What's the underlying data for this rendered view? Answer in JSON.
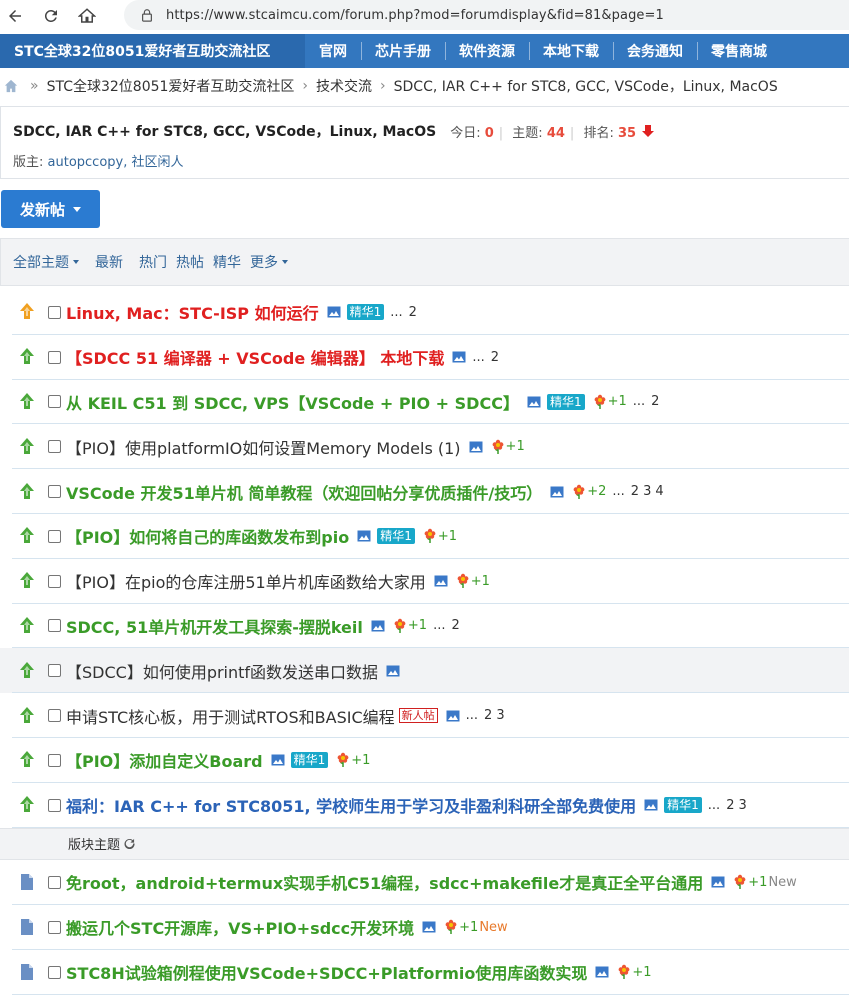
{
  "browser": {
    "url": "https://www.stcaimcu.com/forum.php?mod=forumdisplay&fid=81&page=1"
  },
  "topnav": {
    "brand": "STC全球32位8051爱好者互助交流社区",
    "items": [
      "官网",
      "芯片手册",
      "软件资源",
      "本地下载",
      "会务通知",
      "零售商城"
    ]
  },
  "breadcrumb": [
    "STC全球32位8051爱好者互助交流社区",
    "技术交流",
    "SDCC, IAR C++ for STC8, GCC, VSCode，Linux, MacOS"
  ],
  "forum": {
    "title": "SDCC, IAR C++ for STC8, GCC, VSCode，Linux, MacOS",
    "today_label": "今日:",
    "today": "0",
    "topics_label": "主题:",
    "topics": "44",
    "rank_label": "排名:",
    "rank": "35",
    "moderators_label": "版主:",
    "moderators": "autopccopy, 社区闲人"
  },
  "new_post_label": "发新帖",
  "filters": {
    "all": "全部主题",
    "latest": "最新",
    "hot": "热门",
    "hot_posts": "热帖",
    "digest": "精华",
    "more": "更多"
  },
  "section_label": "版块主题",
  "threads": [
    {
      "title": "Linux, Mac：STC-ISP 如何运行",
      "style": "red",
      "icon": "pin-up-orange-icon",
      "image": true,
      "badge": "精华1",
      "flower": false,
      "rep": "",
      "pages_prefix": "...",
      "pages": [
        "2"
      ]
    },
    {
      "title": "【SDCC 51 编译器 + VSCode 编辑器】 本地下载",
      "style": "red",
      "icon": "pin-up-green-icon",
      "image": true,
      "badge": "",
      "flower": false,
      "rep": "",
      "pages_prefix": "...",
      "pages": [
        "2"
      ]
    },
    {
      "title": "从 KEIL C51 到 SDCC, VPS【VSCode + PIO + SDCC】",
      "style": "green",
      "icon": "pin-up-green-icon",
      "image": true,
      "badge": "精华1",
      "flower": true,
      "rep": "+1",
      "pages_prefix": "...",
      "pages": [
        "2"
      ]
    },
    {
      "title": "【PIO】使用platformIO如何设置Memory Models (1)",
      "style": "dark",
      "icon": "pin-up-green-icon",
      "image": true,
      "badge": "",
      "flower": true,
      "rep": "+1",
      "pages_prefix": "",
      "pages": []
    },
    {
      "title": "VSCode 开发51单片机 简单教程（欢迎回帖分享优质插件/技巧）",
      "style": "green",
      "icon": "pin-up-green-icon",
      "image": true,
      "badge": "",
      "flower": true,
      "rep": "+2",
      "pages_prefix": "...",
      "pages": [
        "2",
        "3",
        "4"
      ]
    },
    {
      "title": "【PIO】如何将自己的库函数发布到pio",
      "style": "green",
      "icon": "pin-up-green-icon",
      "image": true,
      "badge": "精华1",
      "flower": true,
      "rep": "+1",
      "pages_prefix": "",
      "pages": []
    },
    {
      "title": "【PIO】在pio的仓库注册51单片机库函数给大家用",
      "style": "dark",
      "icon": "pin-up-green-icon",
      "image": true,
      "badge": "",
      "flower": true,
      "rep": "+1",
      "pages_prefix": "",
      "pages": []
    },
    {
      "title": "SDCC, 51单片机开发工具探索-摆脱keil",
      "style": "green",
      "icon": "pin-up-green-icon",
      "image": true,
      "badge": "",
      "flower": true,
      "rep": "+1",
      "pages_prefix": "...",
      "pages": [
        "2"
      ]
    },
    {
      "title": "【SDCC】如何使用printf函数发送串口数据",
      "style": "dark",
      "icon": "pin-up-green-icon",
      "image": true,
      "badge": "",
      "flower": false,
      "rep": "",
      "pages_prefix": "",
      "pages": [],
      "highlight": true
    },
    {
      "title": "申请STC核心板，用于测试RTOS和BASIC编程",
      "style": "dark",
      "icon": "pin-up-green-icon",
      "image": true,
      "badge": "",
      "newbadge": "新人帖",
      "flower": false,
      "rep": "",
      "pages_prefix": "...",
      "pages": [
        "2",
        "3"
      ]
    },
    {
      "title": "【PIO】添加自定义Board",
      "style": "green",
      "icon": "pin-up-green-icon",
      "image": true,
      "badge": "精华1",
      "flower": true,
      "rep": "+1",
      "pages_prefix": "",
      "pages": []
    },
    {
      "title": "福利：IAR C++ for STC8051, 学校师生用于学习及非盈利科研全部免费使用",
      "style": "blue",
      "icon": "pin-up-green-icon",
      "image": true,
      "badge": "精华1",
      "flower": false,
      "rep": "",
      "pages_prefix": "...",
      "pages": [
        "2",
        "3"
      ]
    }
  ],
  "section_threads": [
    {
      "title": "免root，android+termux实现手机C51编程，sdcc+makefile才是真正全平台通用",
      "style": "green",
      "icon": "document-icon",
      "image": true,
      "flower": true,
      "rep": "+1",
      "newtext": "New",
      "newcolor": "gray"
    },
    {
      "title": "搬运几个STC开源库，VS+PIO+sdcc开发环境",
      "style": "green",
      "icon": "document-icon",
      "image": true,
      "flower": true,
      "rep": "+1",
      "newtext": "New",
      "newcolor": "orange"
    },
    {
      "title": "STC8H试验箱例程使用VSCode+SDCC+Platformio使用库函数实现",
      "style": "green",
      "icon": "document-icon",
      "image": true,
      "flower": true,
      "rep": "+1",
      "newtext": "",
      "newcolor": "gray"
    }
  ]
}
